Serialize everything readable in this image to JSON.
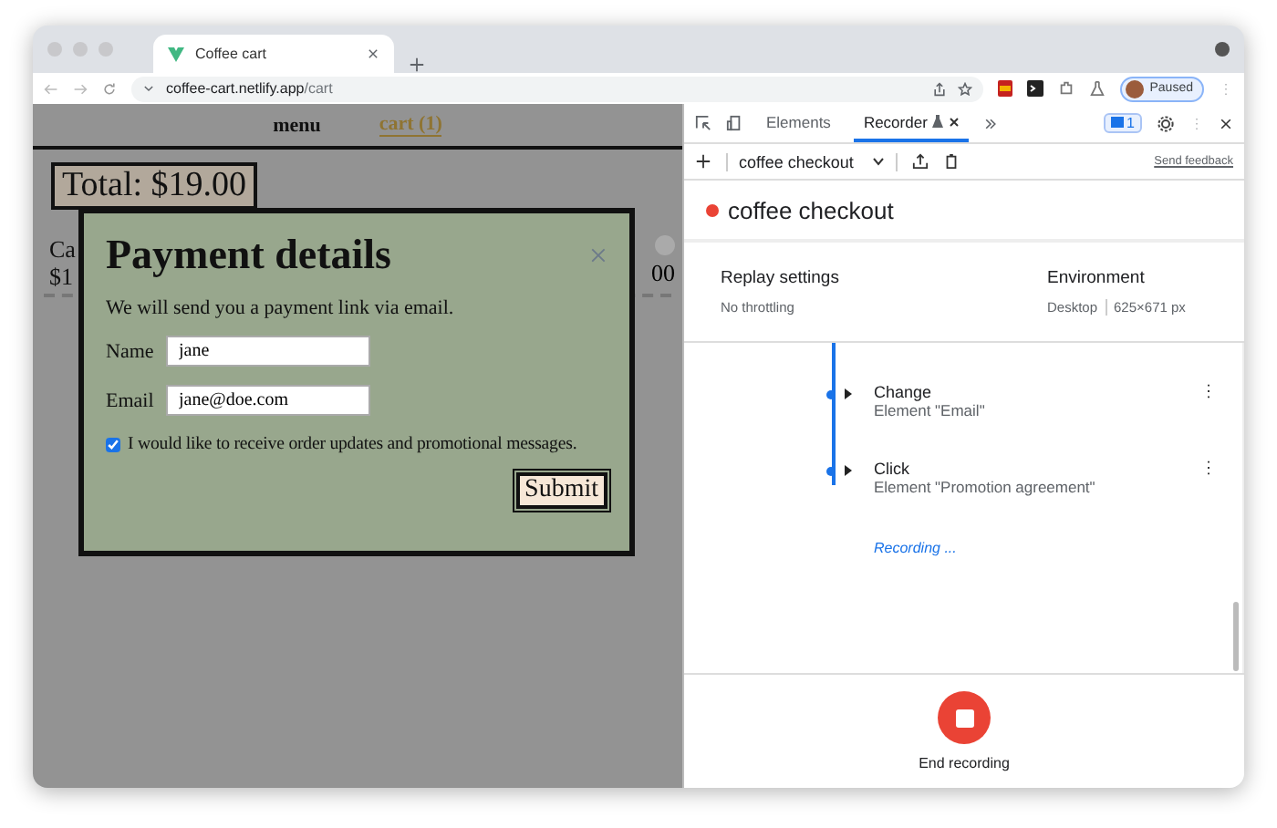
{
  "browser": {
    "tab_title": "Coffee cart",
    "url_host": "coffee-cart.netlify.app",
    "url_path": "/cart",
    "profile_label": "Paused"
  },
  "page": {
    "nav": [
      {
        "label": "menu",
        "selected": false
      },
      {
        "label": "cart (1)",
        "selected": true
      }
    ],
    "total": "Total: $19.00",
    "cart_item": {
      "name_visible": "Ca",
      "price_visible": "$1",
      "amount_visible": "00"
    }
  },
  "modal": {
    "title": "Payment details",
    "close": "×",
    "intro": "We will send you a payment link via email.",
    "fields": [
      {
        "label": "Name",
        "value": "jane"
      },
      {
        "label": "Email",
        "value": "jane@doe.com"
      }
    ],
    "consent": {
      "label": "I would like to receive order updates and promotional messages.",
      "checked": true
    },
    "submit": "Submit"
  },
  "devtools": {
    "tabs": [
      {
        "label": "Elements",
        "selected": false
      },
      {
        "label": "Recorder",
        "selected": true
      }
    ],
    "issues_count": "1",
    "recording_select": "coffee checkout",
    "send_feedback": "Send feedback",
    "recording_title": "coffee checkout",
    "replay_settings": {
      "heading": "Replay settings",
      "value": "No throttling"
    },
    "environment": {
      "heading": "Environment",
      "device": "Desktop",
      "size": "625×671 px"
    },
    "steps": [
      {
        "title": "Change",
        "detail": "Element \"Email\""
      },
      {
        "title": "Click",
        "detail": "Element \"Promotion agreement\""
      }
    ],
    "status": "Recording ...",
    "end_button": "End recording"
  }
}
